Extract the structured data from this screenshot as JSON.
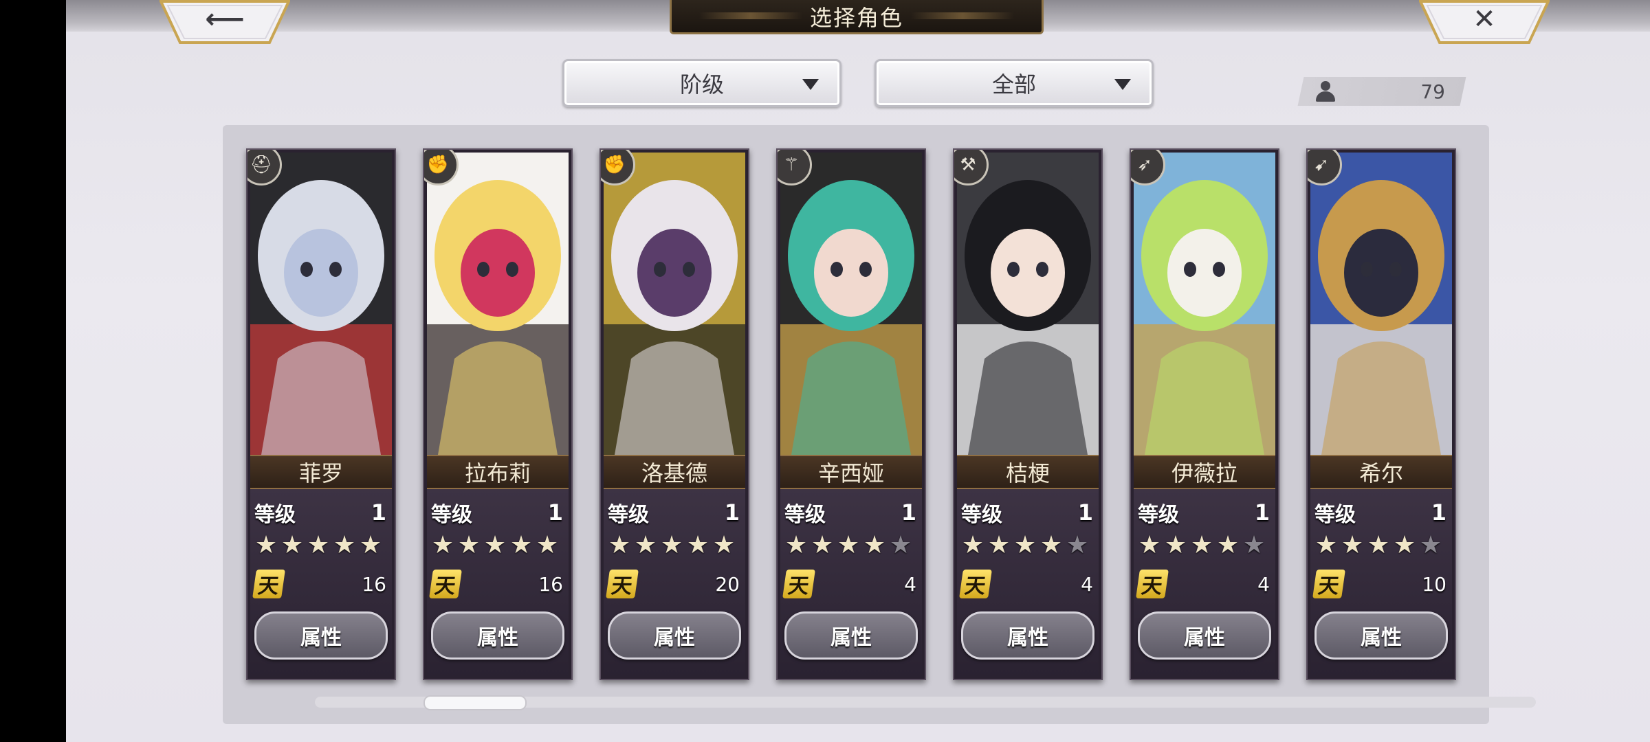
{
  "header": {
    "title": "选择角色",
    "back_icon": "arrow-left-icon",
    "close_icon": "close-icon"
  },
  "filters": {
    "sort_label": "阶级",
    "scope_label": "全部"
  },
  "counter": {
    "icon": "person-icon",
    "value": "79"
  },
  "attr_button_label": "属性",
  "level_label": "等级",
  "rank_label": "天",
  "characters": [
    {
      "name": "菲罗",
      "level": "1",
      "stars": 5,
      "rank_value": "16",
      "class_icon": "helmet-icon",
      "palette": [
        "#d7dbe6",
        "#b8c3de",
        "#2a2a2e",
        "#c33a3a"
      ]
    },
    {
      "name": "拉布莉",
      "level": "1",
      "stars": 5,
      "rank_value": "16",
      "class_icon": "fist-icon",
      "palette": [
        "#f3d56a",
        "#d1375e",
        "#f4f2ef",
        "#3a2f2f"
      ]
    },
    {
      "name": "洛基德",
      "level": "1",
      "stars": 5,
      "rank_value": "20",
      "class_icon": "fist-icon",
      "palette": [
        "#e9e4ea",
        "#5a3d6a",
        "#b69a3a",
        "#2a2a22"
      ]
    },
    {
      "name": "辛西娅",
      "level": "1",
      "stars": 4,
      "rank_value": "4",
      "class_icon": "staff-icon",
      "palette": [
        "#3fb6a0",
        "#f1d9cf",
        "#2a2a2a",
        "#c9a24a"
      ]
    },
    {
      "name": "桔梗",
      "level": "1",
      "stars": 4,
      "rank_value": "4",
      "class_icon": "axe-icon",
      "palette": [
        "#1b1b1f",
        "#f3e1d7",
        "#3b3b40",
        "#f6f6f6"
      ]
    },
    {
      "name": "伊薇拉",
      "level": "1",
      "stars": 4,
      "rank_value": "4",
      "class_icon": "spear-icon",
      "palette": [
        "#b9e069",
        "#f3f1ea",
        "#7fb3d9",
        "#c9a24a"
      ]
    },
    {
      "name": "希尔",
      "level": "1",
      "stars": 4,
      "rank_value": "10",
      "class_icon": "bow-icon",
      "palette": [
        "#c79a4d",
        "#2b2b3d",
        "#3b56a6",
        "#f1e8d9"
      ]
    }
  ],
  "colors": {
    "title_bar": "#1b1510",
    "title_border": "#8d7346",
    "name_plate": "#3b2a1d",
    "rank_badge": "#f0c83a"
  }
}
